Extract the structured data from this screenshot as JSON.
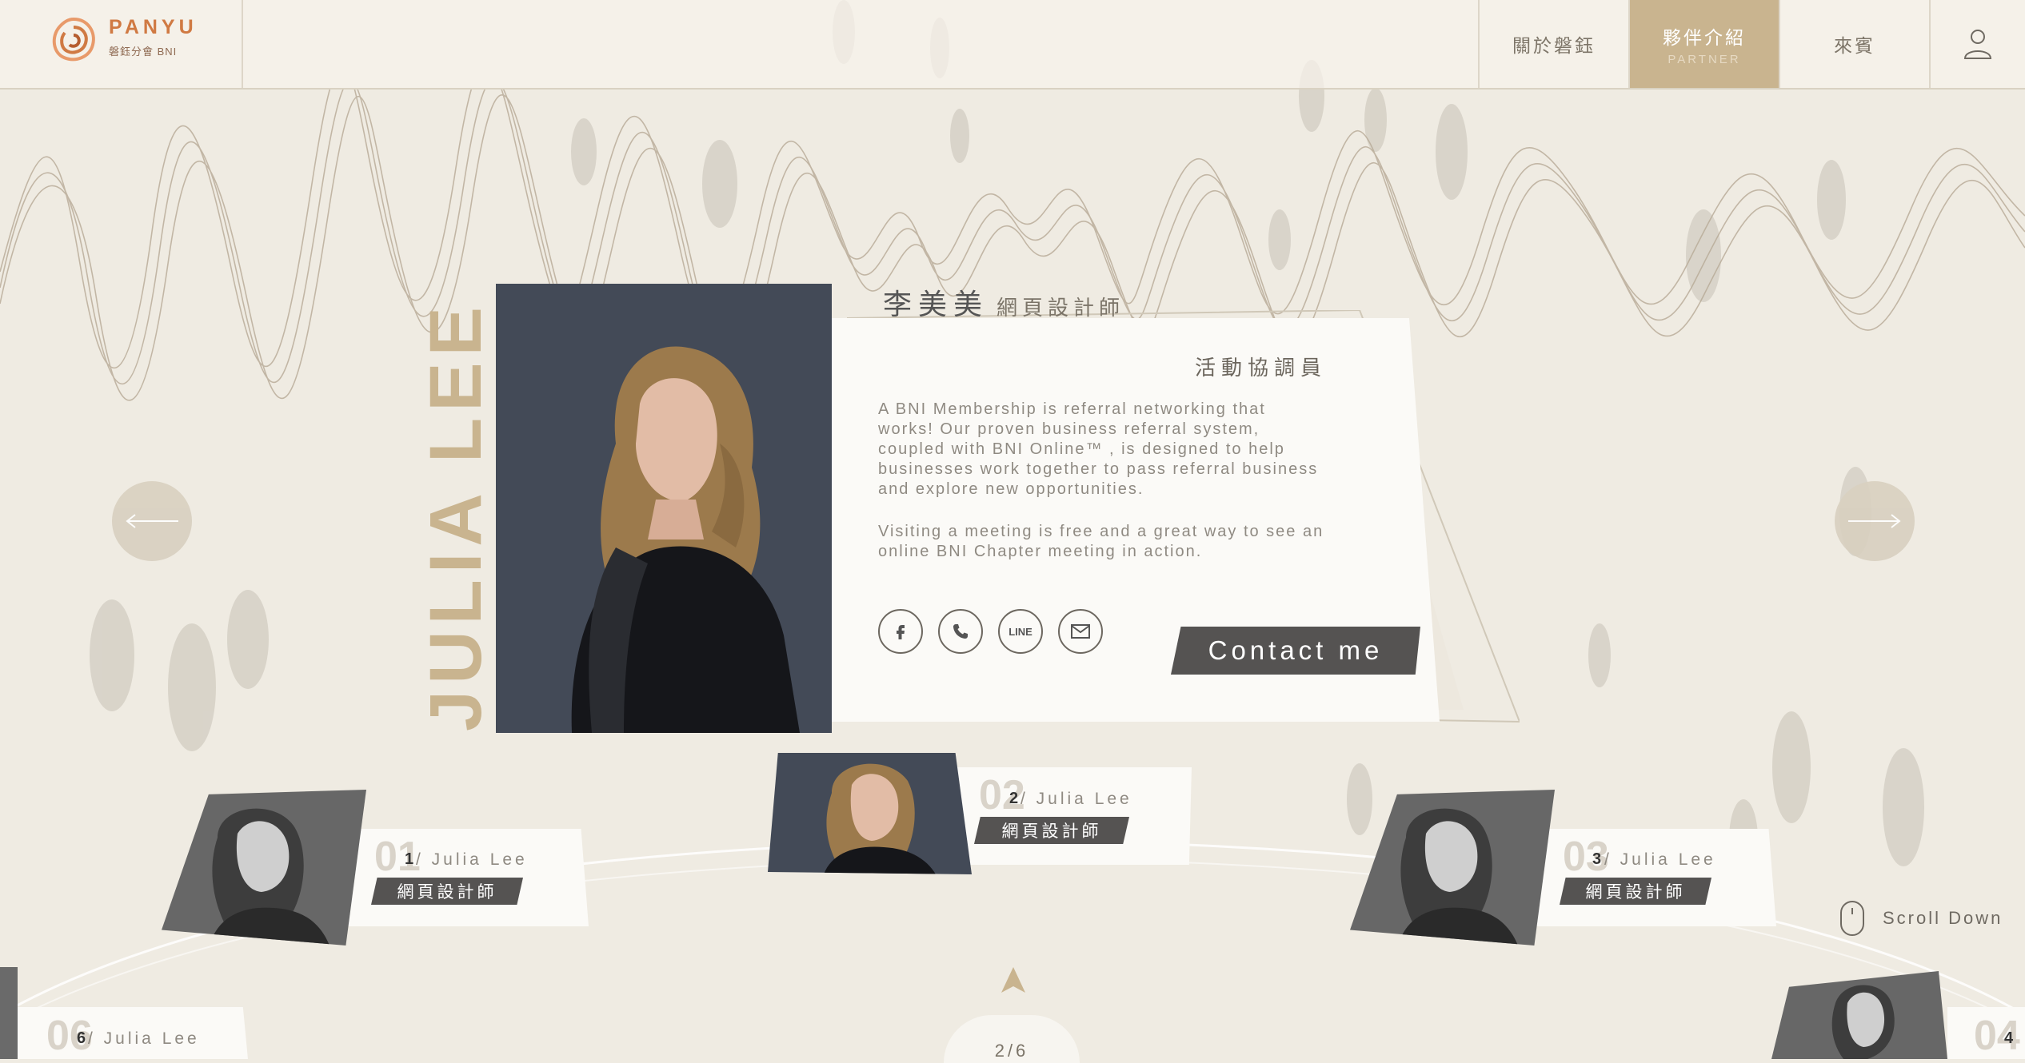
{
  "brand": {
    "name": "PANYU",
    "tagline": "磐鈺分會  BNI"
  },
  "nav": {
    "items": [
      {
        "label": "關於磐鈺",
        "sub": ""
      },
      {
        "label": "夥伴介紹",
        "sub": "PARTNER"
      },
      {
        "label": "來賓",
        "sub": ""
      }
    ]
  },
  "profile": {
    "english_name": "JULIA LEE",
    "name": "李美美",
    "title": "網頁設計師",
    "role": "活動協調員",
    "bio": [
      "A BNI Membership is referral networking that works! Our proven business referral system, coupled with BNI Online™ , is designed to help businesses work together to pass referral business and explore new opportunities.",
      "Visiting a meeting is free and a great way to see an online BNI Chapter meeting in action."
    ],
    "contact_label": "Contact me",
    "social": [
      "facebook-icon",
      "phone-icon",
      "line-icon",
      "mail-icon"
    ],
    "line_text": "LINE"
  },
  "thumbnails": [
    {
      "num": "01",
      "index": "1",
      "name": "/ Julia Lee",
      "role": "網頁設計師"
    },
    {
      "num": "02",
      "index": "2",
      "name": "/ Julia Lee",
      "role": "網頁設計師"
    },
    {
      "num": "03",
      "index": "3",
      "name": "/ Julia Lee",
      "role": "網頁設計師"
    },
    {
      "num": "06",
      "index": "6",
      "name": "/ Julia Lee",
      "role": ""
    },
    {
      "num": "04",
      "index": "4",
      "name": "",
      "role": ""
    }
  ],
  "scroll_label": "Scroll Down",
  "pager": "2/6",
  "colors": {
    "accent": "#c9b48f",
    "brand": "#d07a43",
    "dark": "#555352",
    "bg": "#efebe2"
  }
}
